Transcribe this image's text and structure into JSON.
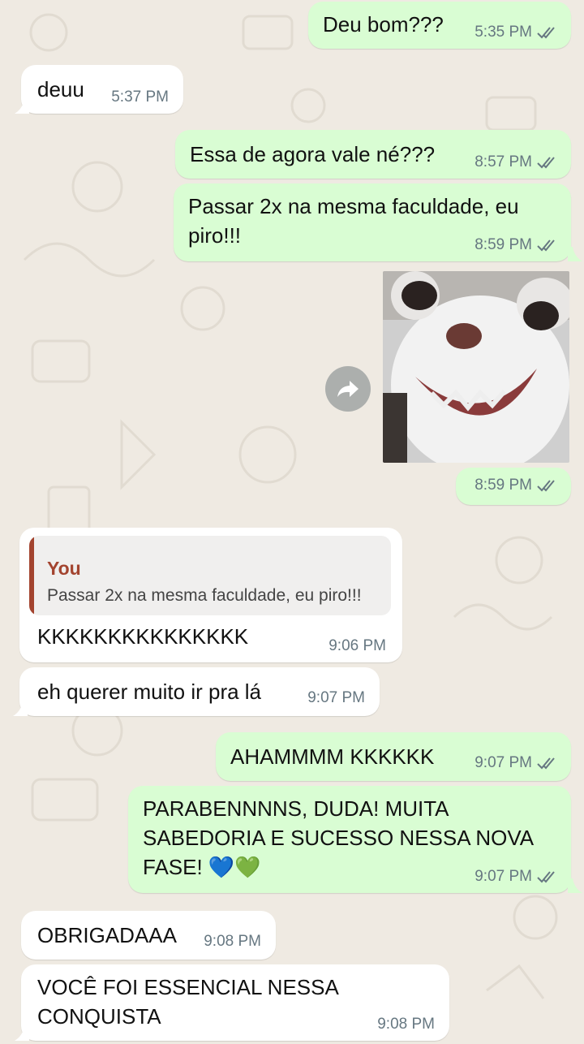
{
  "messages": [
    {
      "text": "Deu bom???",
      "time": "5:35 PM"
    },
    {
      "text": "deuu",
      "time": "5:37 PM"
    },
    {
      "text": "Essa de agora vale né???",
      "time": "8:57 PM"
    },
    {
      "text": "Passar 2x na mesma faculdade, eu\npiro!!!",
      "time": "8:59 PM"
    },
    {
      "time": "8:59 PM"
    },
    {
      "quote_author": "You",
      "quote_text": "Passar 2x na mesma faculdade, eu piro!!!",
      "text": "KKKKKKKKKKKKKKK",
      "time": "9:06 PM"
    },
    {
      "text": "eh querer muito ir pra lá",
      "time": "9:07 PM"
    },
    {
      "text": "AHAMMMM KKKKKK",
      "time": "9:07 PM"
    },
    {
      "text": "PARABENNNNS, DUDA! MUITA\nSABEDORIA E SUCESSO NESSA NOVA\nFASE! 💙💚",
      "time": "9:07 PM"
    },
    {
      "text": "OBRIGADAAA",
      "time": "9:08 PM"
    },
    {
      "text": "VOCÊ FOI ESSENCIAL NESSA\nCONQUISTA",
      "time": "9:08 PM"
    }
  ],
  "colors": {
    "outgoing_bubble": "#d9fdd3",
    "incoming_bubble": "#ffffff",
    "background": "#efeae2",
    "quote_accent": "#a3442f",
    "read_ticks": "#667781"
  }
}
